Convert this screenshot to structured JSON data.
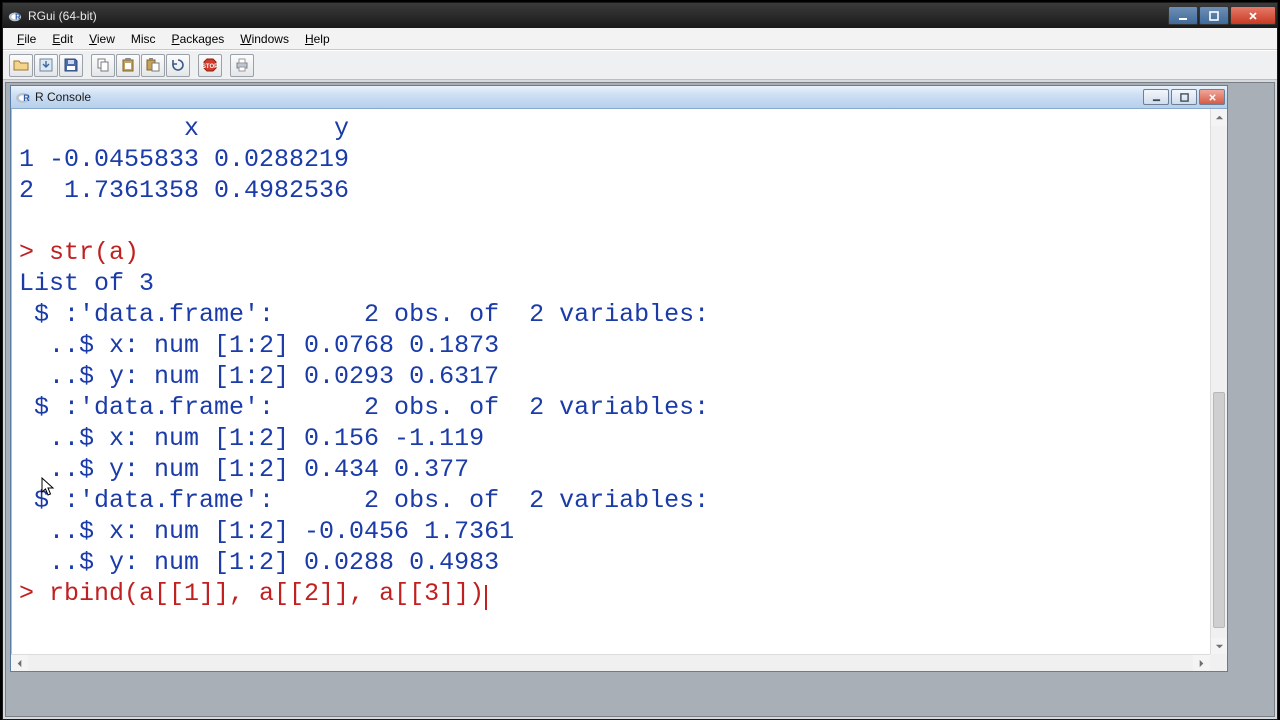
{
  "window": {
    "title": "RGui (64-bit)"
  },
  "menus": {
    "file": "File",
    "edit": "Edit",
    "view": "View",
    "misc": "Misc",
    "packages": "Packages",
    "windows": "Windows",
    "help": "Help"
  },
  "toolbar": {
    "open": "open-script",
    "load": "load-workspace",
    "save": "save-workspace",
    "copy": "copy",
    "paste": "paste",
    "copypaste": "copy-paste",
    "stop": "stop",
    "print": "print"
  },
  "console": {
    "title": "R Console",
    "lines": {
      "hdr": "           x         y",
      "row1": "1 -0.0455833 0.0288219",
      "row2": "2  1.7361358 0.4982536",
      "blank": "",
      "prompt1": "> ",
      "cmd1": "str(a)",
      "o1": "List of 3",
      "o2": " $ :'data.frame':      2 obs. of  2 variables:",
      "o3": "  ..$ x: num [1:2] 0.0768 0.1873",
      "o4": "  ..$ y: num [1:2] 0.0293 0.6317",
      "o5": " $ :'data.frame':      2 obs. of  2 variables:",
      "o6": "  ..$ x: num [1:2] 0.156 -1.119",
      "o7": "  ..$ y: num [1:2] 0.434 0.377",
      "o8": " $ :'data.frame':      2 obs. of  2 variables:",
      "o9": "  ..$ x: num [1:2] -0.0456 1.7361",
      "o10": "  ..$ y: num [1:2] 0.0288 0.4983",
      "prompt2": "> ",
      "cmd2": "rbind(a[[1]], a[[2]], a[[3]])"
    }
  }
}
